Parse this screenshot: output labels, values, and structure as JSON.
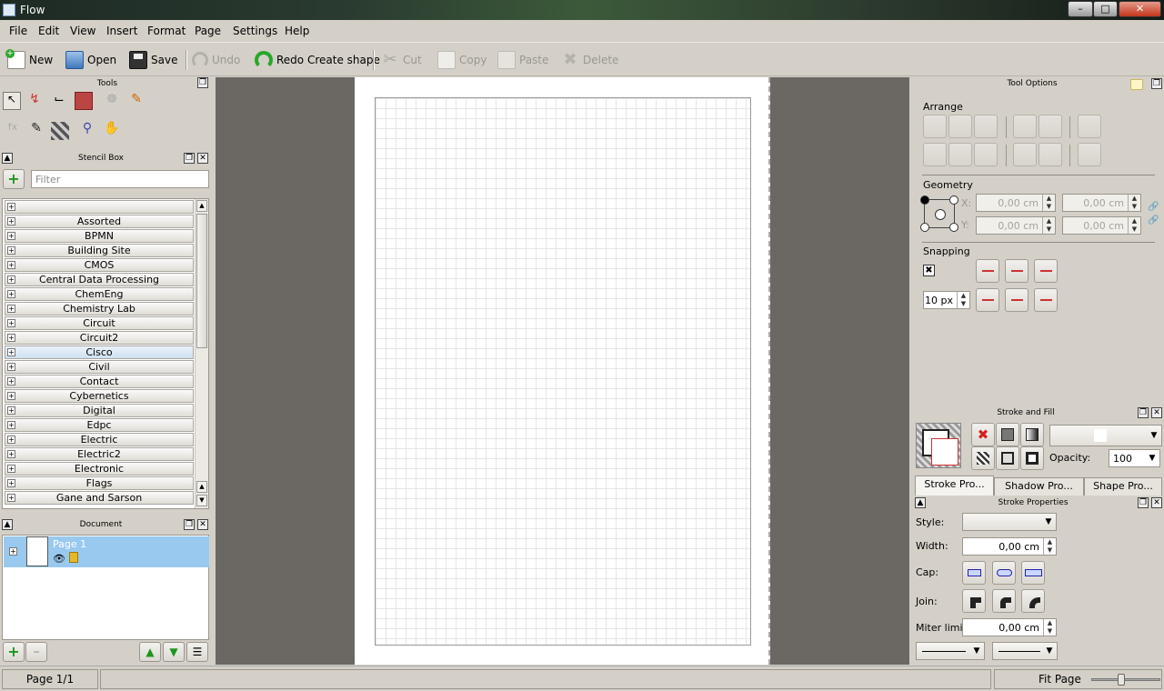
{
  "window": {
    "title": "Flow"
  },
  "menu": [
    "File",
    "Edit",
    "View",
    "Insert",
    "Format",
    "Page",
    "Settings",
    "Help"
  ],
  "toolbar": {
    "new": "New",
    "open": "Open",
    "save": "Save",
    "undo": "Undo",
    "redo": "Redo Create shape",
    "cut": "Cut",
    "copy": "Copy",
    "paste": "Paste",
    "delete": "Delete"
  },
  "docks": {
    "tools": "Tools",
    "stencil_box": "Stencil Box",
    "document": "Document",
    "tool_options": "Tool Options",
    "stroke_and_fill": "Stroke and Fill",
    "stroke_properties": "Stroke Properties"
  },
  "stencil": {
    "filter_placeholder": "Filter",
    "items": [
      "",
      "Assorted",
      "BPMN",
      "Building Site",
      "CMOS",
      "Central Data Processing",
      "ChemEng",
      "Chemistry Lab",
      "Circuit",
      "Circuit2",
      "Cisco",
      "Civil",
      "Contact",
      "Cybernetics",
      "Digital",
      "Edpc",
      "Electric",
      "Electric2",
      "Electronic",
      "Flags",
      "Gane and Sarson"
    ],
    "selected": "Cisco"
  },
  "document": {
    "page_label": "Page  1"
  },
  "tool_options": {
    "arrange": "Arrange",
    "geometry": "Geometry",
    "x_label": "X:",
    "y_label": "Y:",
    "x_val": "0,00 cm",
    "x_w": "0,00 cm",
    "y_val": "0,00 cm",
    "y_h": "0,00 cm",
    "snapping": "Snapping",
    "snap_distance": "10 px"
  },
  "stroke_fill": {
    "opacity_label": "Opacity:",
    "opacity": "100"
  },
  "tabs": [
    "Stroke Pro...",
    "Shadow Pro...",
    "Shape Pro..."
  ],
  "stroke_props": {
    "style": "Style:",
    "width": "Width:",
    "width_val": "0,00 cm",
    "cap": "Cap:",
    "join": "Join:",
    "miter": "Miter limit:",
    "miter_val": "0,00 cm"
  },
  "status": {
    "page": "Page 1/1",
    "zoom": "Fit Page"
  }
}
